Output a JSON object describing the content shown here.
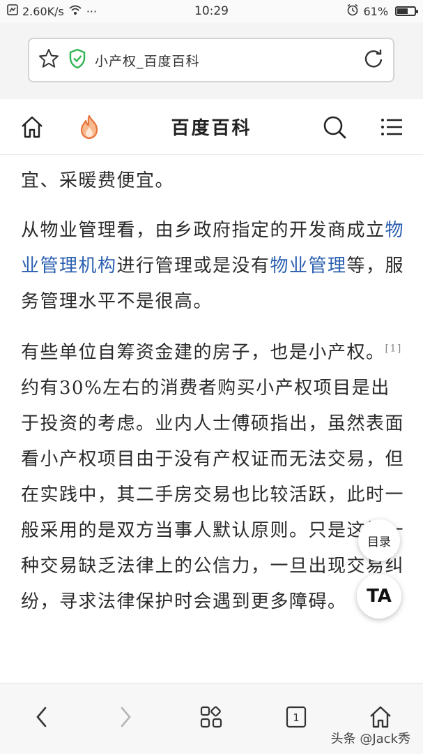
{
  "status_bar": {
    "speed": "2.60K/s",
    "dots": "···",
    "time": "10:29",
    "battery": "61%",
    "battery_level": 0.61
  },
  "address_bar": {
    "url_text": "小产权_百度百科"
  },
  "site_header": {
    "title": "百度百科"
  },
  "article": {
    "para1": "宜、采暖费便宜。",
    "para2": {
      "t1": "从物业管理看，由乡政府指定的开发商成立",
      "link1": "物业管理机构",
      "t2": "进行管理或是没有",
      "link2": "物业管理",
      "t3": "等，服务管理水平不是很高。"
    },
    "para3": {
      "t1": "有些单位自筹资金建的房子，也是小产权。",
      "ref": "[1]",
      "t2": " 约有30%左右的消费者购买小产权项目是出于投资的考虑。业内人士傅硕指出，虽然表面看小产权项目由于没有产权证而无法交易，但在实践中，其二手房交易也比较活跃，此时一般采用的是双方当事人默认原则。只是这样一种交易缺乏法律上的公信力，一旦出现交易纠纷，寻求法律保护时会遇到更多障碍。"
    }
  },
  "floating": {
    "toc_label": "目录",
    "ta_label": "TA"
  },
  "bottom_bar": {
    "tab_count": "1",
    "watermark": "头条 @Jack秀"
  }
}
